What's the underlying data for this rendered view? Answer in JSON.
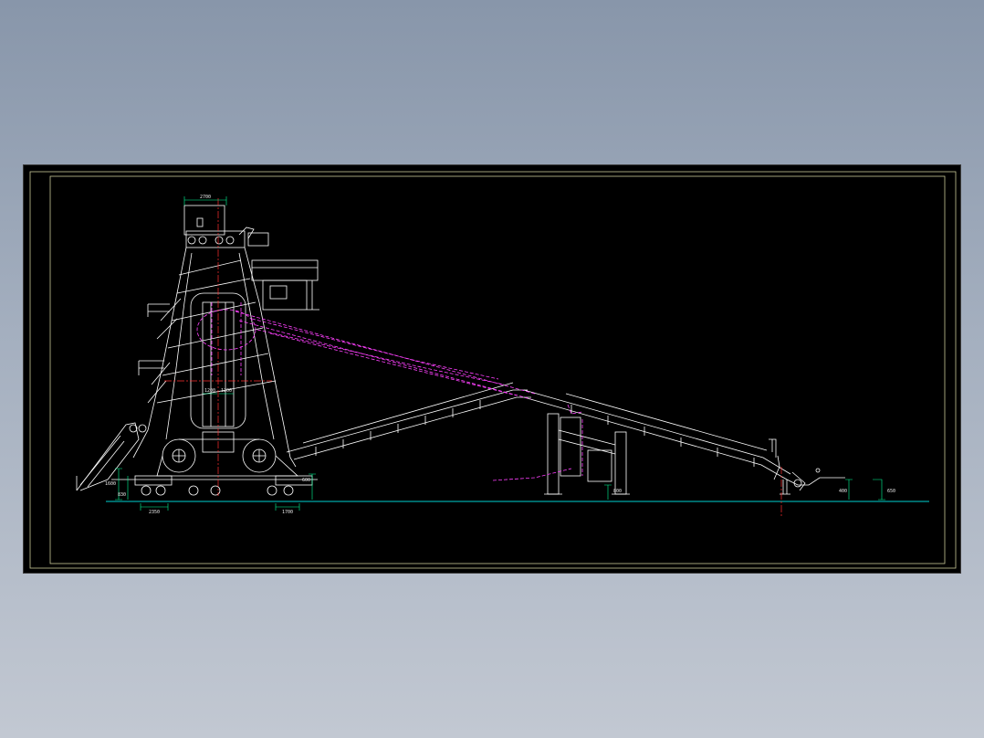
{
  "colors": {
    "background": "#8f9bad",
    "sheet": "#000000",
    "frame": "#c8c898",
    "structure": "#ffffff",
    "hidden_lines": "#ff40ff",
    "centerline": "#ff3030",
    "dimension": "#00ff99",
    "ground": "#00d0d0"
  },
  "dimensions": {
    "top_width": "2700",
    "shaft_width_left": "1200",
    "shaft_width_right": "1200",
    "left_height_a": "1600",
    "left_height_b": "830",
    "left_base": "2350",
    "right_base": "1700",
    "right_height": "600",
    "support_height": "800",
    "end_height_a": "400",
    "end_height_b": "650"
  }
}
